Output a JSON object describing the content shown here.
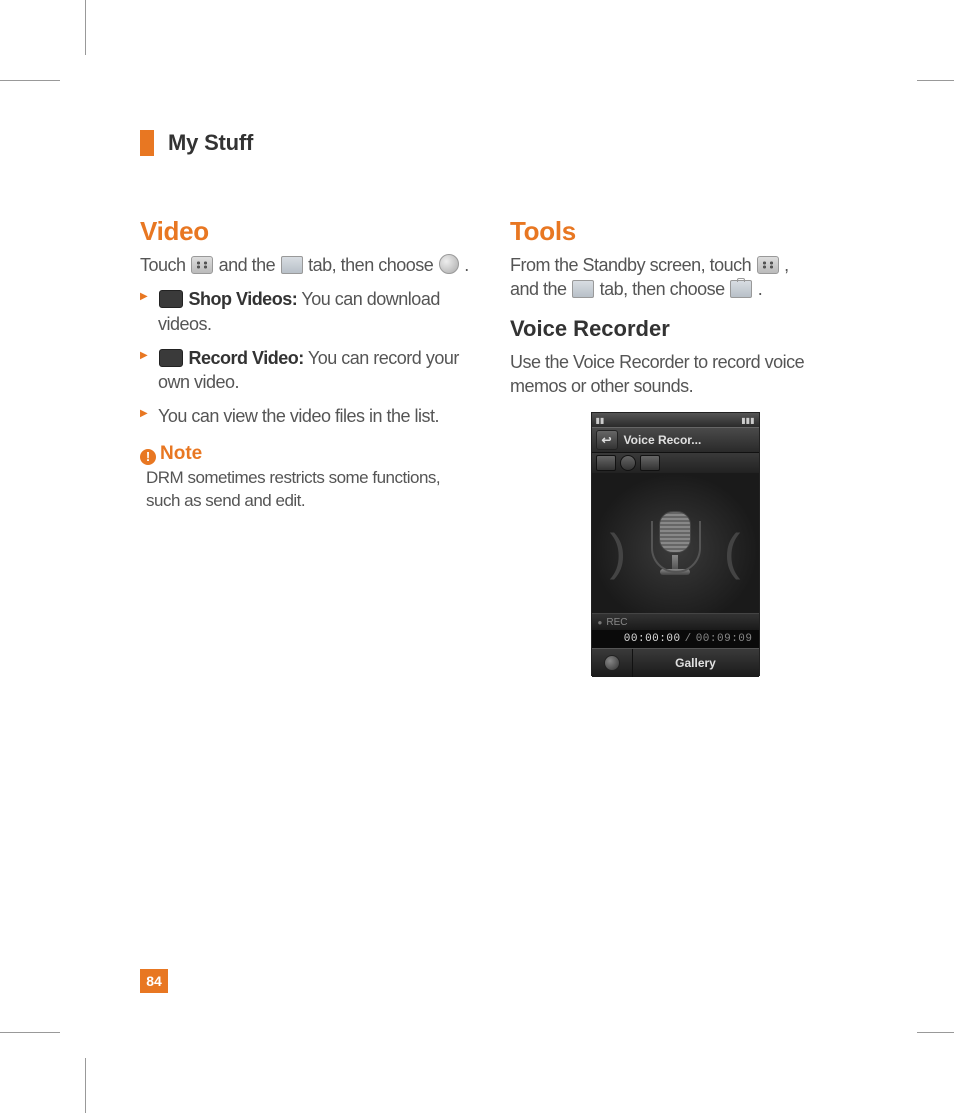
{
  "header": {
    "title": "My Stuff"
  },
  "pageNumber": "84",
  "left": {
    "heading": "Video",
    "intro_pre": "Touch ",
    "intro_mid": " and the ",
    "intro_post": " tab, then choose ",
    "intro_end": ".",
    "bullets": [
      {
        "bold": "Shop Videos:",
        "text": " You can download videos.",
        "icon": true
      },
      {
        "bold": "Record Video:",
        "text": " You can record your own video.",
        "icon": true
      },
      {
        "bold": "",
        "text": "You can view the video files in the list.",
        "icon": false
      }
    ],
    "note_label": "Note",
    "note_body": "DRM sometimes restricts some functions, such as send and edit."
  },
  "right": {
    "heading": "Tools",
    "intro_line1_pre": "From the Standby screen, touch ",
    "intro_line1_post": ",",
    "intro_line2_pre": "and the ",
    "intro_line2_mid": " tab, then choose ",
    "intro_line2_end": ".",
    "sub": "Voice Recorder",
    "sub_body": "Use the Voice Recorder to record voice memos or other sounds."
  },
  "phone": {
    "title": "Voice Recor...",
    "rec_label": "REC",
    "time_elapsed": "00:00:00",
    "time_total": "00:09:09",
    "gallery": "Gallery"
  }
}
